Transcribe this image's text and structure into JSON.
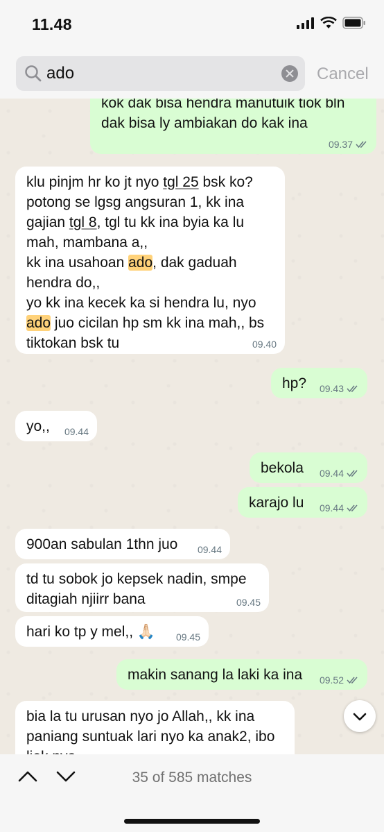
{
  "status": {
    "time": "11.48"
  },
  "search": {
    "query": "ado",
    "cancel_label": "Cancel"
  },
  "messages": [
    {
      "lines": [
        "kok dak bisa hendra manutuik tiok bln",
        "dak bisa ly ambiakan do kak ina"
      ],
      "time": "09.37"
    },
    {
      "l1": "klu pinjm hr ko jt nyo ",
      "l1u": "tgl 25",
      "l1b": " bsk ko?",
      "l2": "potong se lgsg angsuran 1, kk ina",
      "l3": "gajian ",
      "l3u": "tgl 8",
      "l3b": ", tgl tu kk ina byia ka lu",
      "l4": "mah, mambana a,,",
      "l5": "kk ina usahoan ",
      "l5h": "ado",
      "l5b": ", dak gaduah",
      "l6": "hendra do,,",
      "l7": "yo kk ina kecek ka si hendra lu, nyo",
      "l8h": "ado",
      "l8b": " juo cicilan hp sm kk ina mah,, bs",
      "l9": "tiktokan bsk tu",
      "time": "09.40"
    },
    {
      "text": "hp?",
      "time": "09.43"
    },
    {
      "text": "yo,,",
      "time": "09.44"
    },
    {
      "text": "bekola",
      "time": "09.44"
    },
    {
      "text": "karajo lu",
      "time": "09.44"
    },
    {
      "text": "900an sabulan 1thn juo",
      "time": "09.44"
    },
    {
      "lines": [
        "td tu sobok jo kepsek nadin, smpe",
        "ditagiah njiirr bana"
      ],
      "time": "09.45"
    },
    {
      "text": "hari ko tp y mel,, 🙏🏻",
      "time": "09.45"
    },
    {
      "text": "makin sanang la laki ka ina",
      "time": "09.52"
    },
    {
      "lines": [
        "bia la tu urusan nyo jo Allah,, kk ina",
        "paniang suntuak lari nyo ka anak2, ibo",
        "liek nyo"
      ]
    }
  ],
  "footer": {
    "matches": "35 of 585 matches"
  }
}
